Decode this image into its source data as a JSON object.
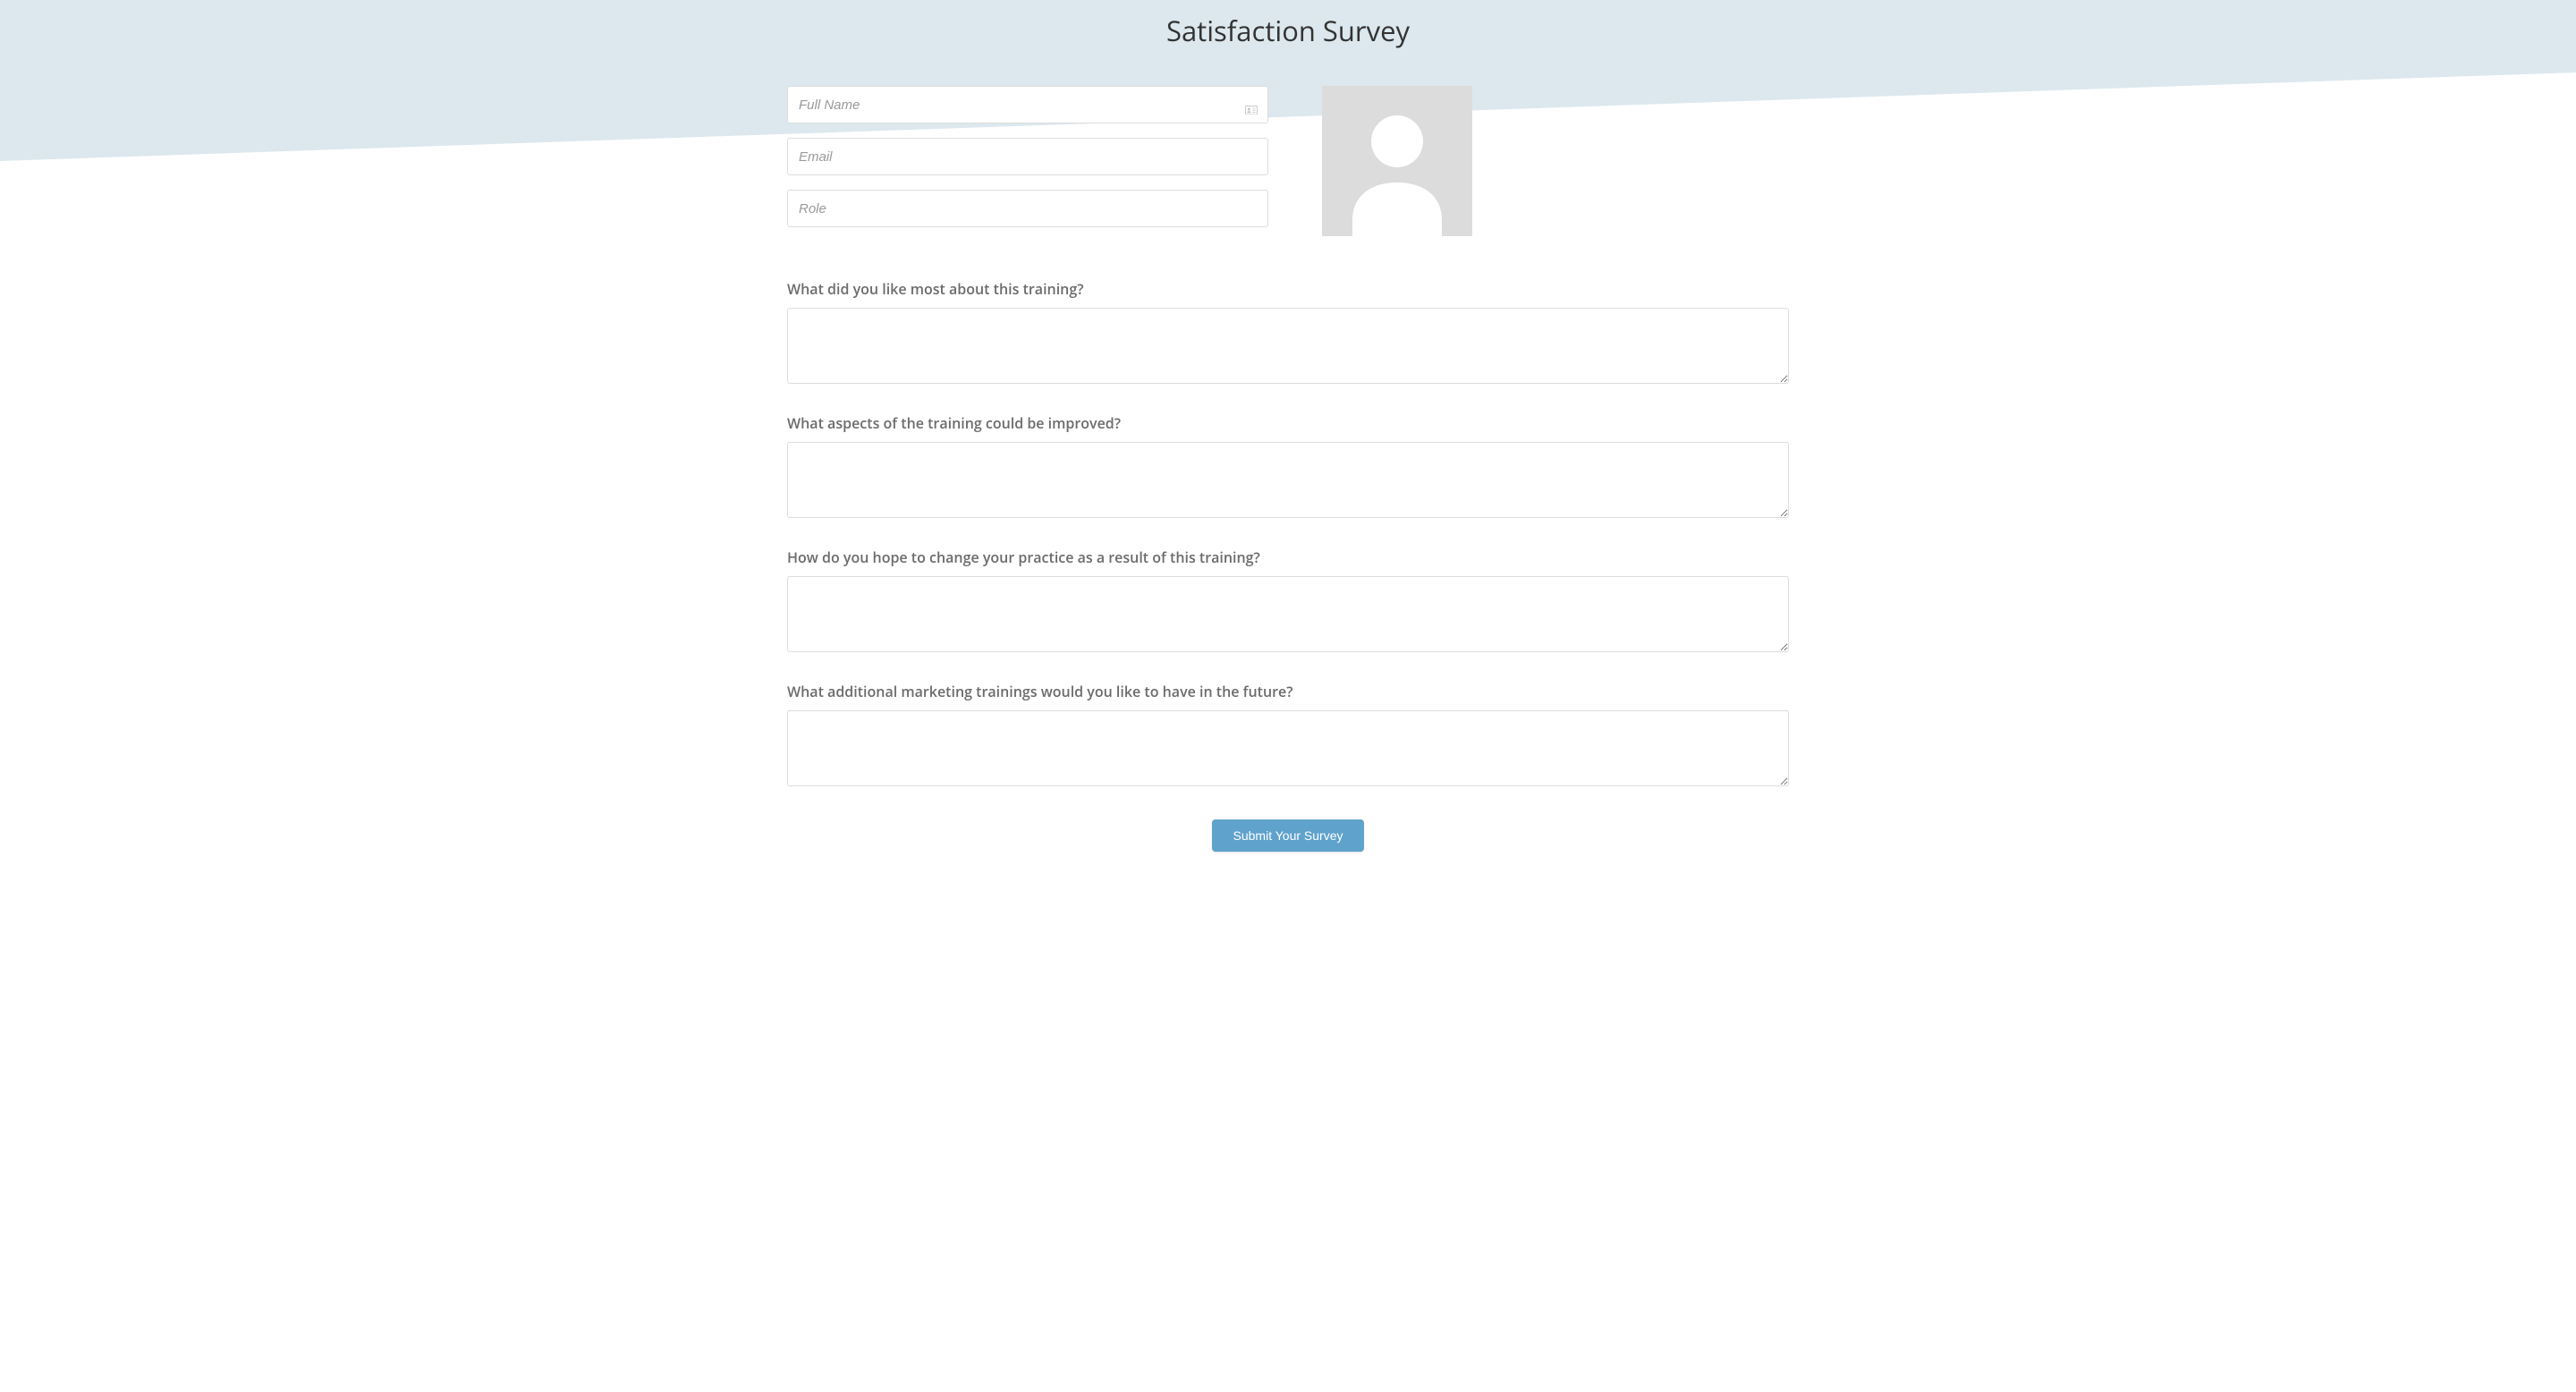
{
  "title": "Satisfaction Survey",
  "fields": {
    "fullName": {
      "placeholder": "Full Name",
      "value": ""
    },
    "email": {
      "placeholder": "Email",
      "value": ""
    },
    "role": {
      "placeholder": "Role",
      "value": ""
    }
  },
  "questions": [
    {
      "label": "What did you like most about this training?",
      "value": ""
    },
    {
      "label": "What aspects of the training could be improved?",
      "value": ""
    },
    {
      "label": "How do you hope to change your practice as a result of this training?",
      "value": ""
    },
    {
      "label": "What additional marketing trainings would you like to have in the future?",
      "value": ""
    }
  ],
  "submit": {
    "label": "Submit Your Survey"
  }
}
